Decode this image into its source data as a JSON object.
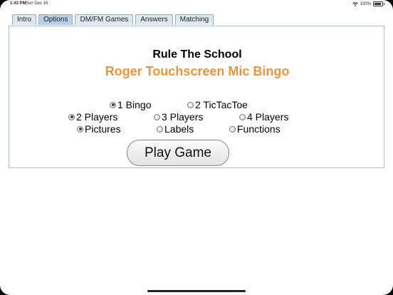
{
  "status_bar": {
    "time": "1:43 PM",
    "date": "Sun Dec 16",
    "battery_percent": "100%"
  },
  "tabs": [
    {
      "label": "Intro",
      "active": false
    },
    {
      "label": "Options",
      "active": true
    },
    {
      "label": "DM/FM Games",
      "active": false
    },
    {
      "label": "Answers",
      "active": false
    },
    {
      "label": "Matching",
      "active": false
    }
  ],
  "main": {
    "title": "Rule The School",
    "subtitle": "Roger Touchscreen Mic Bingo",
    "subtitle_color": "#f0933a",
    "game_type": {
      "options": [
        "1 Bingo",
        "2 TicTacToe"
      ],
      "selected": "1 Bingo"
    },
    "players": {
      "options": [
        "2 Players",
        "3 Players",
        "4 Players"
      ],
      "selected": "2 Players"
    },
    "display": {
      "options": [
        "Pictures",
        "Labels",
        "Functions"
      ],
      "selected": "Pictures"
    },
    "play_button_label": "Play Game"
  }
}
